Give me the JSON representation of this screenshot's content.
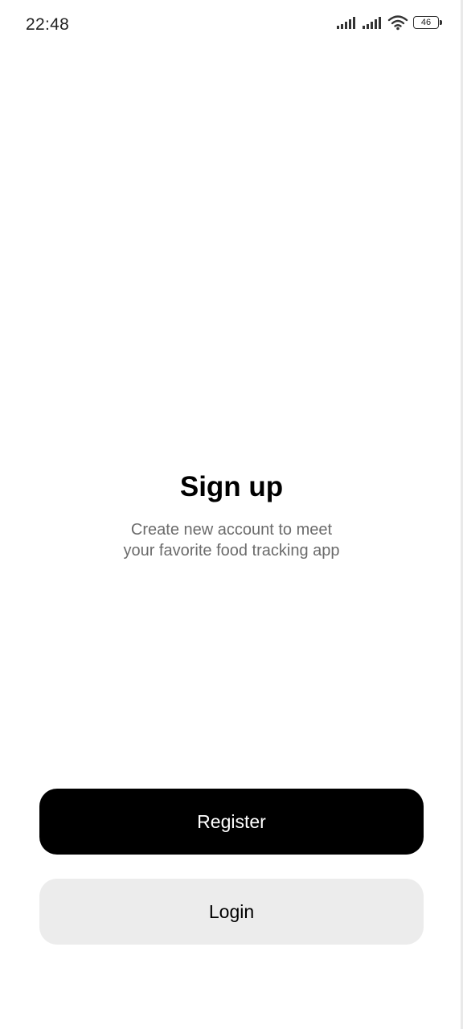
{
  "status_bar": {
    "time": "22:48",
    "battery": "46",
    "icons": [
      "signal-icon",
      "signal-icon",
      "wifi-icon",
      "battery-icon"
    ]
  },
  "main": {
    "title": "Sign up",
    "subtitle_lines": [
      "Create new account to meet",
      "your favorite food tracking app"
    ]
  },
  "actions": {
    "register_label": "Register",
    "login_label": "Login"
  },
  "colors": {
    "primary": "#000000",
    "secondary_bg": "#ececec",
    "subtitle": "#6b6b6b"
  }
}
